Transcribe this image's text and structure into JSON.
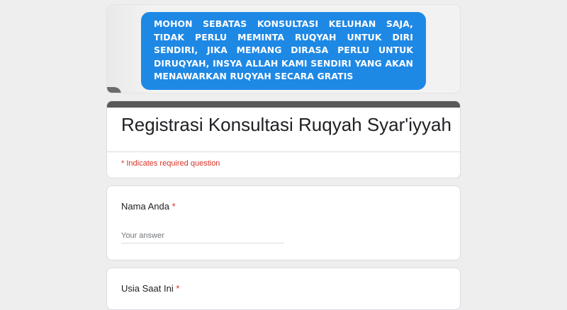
{
  "banner": {
    "text": "MOHON SEBATAS KONSULTASI KELUHAN SAJA, TIDAK PERLU MEMINTA RUQYAH UNTUK DIRI SENDIRI, JIKA MEMANG DIRASA PERLU UNTUK DIRUQYAH, INSYA ALLAH KAMI SENDIRI YANG AKAN MENAWARKAN RUQYAH SECARA GRATIS",
    "box_color": "#1e88e5"
  },
  "form": {
    "title": "Registrasi Konsultasi Ruqyah Syar'iyyah",
    "required_note": "* Indicates required question",
    "header_bar_color": "#595959"
  },
  "questions": [
    {
      "label": "Nama Anda",
      "required_mark": "*",
      "placeholder": "Your answer",
      "value": ""
    },
    {
      "label": "Usia Saat Ini",
      "required_mark": "*"
    }
  ]
}
